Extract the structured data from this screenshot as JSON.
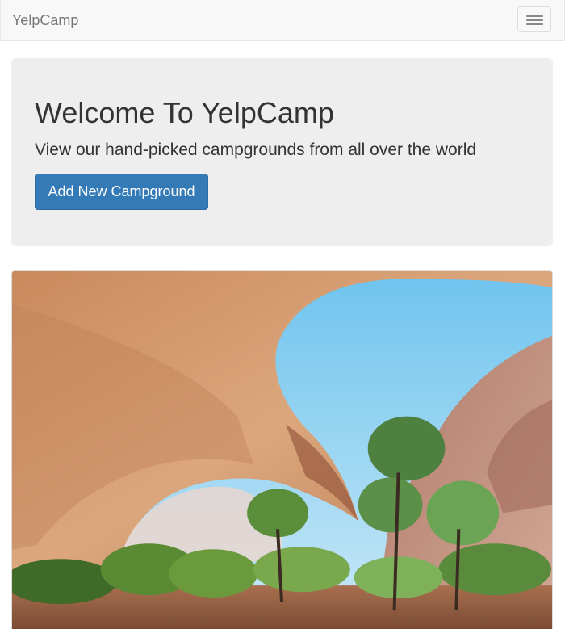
{
  "navbar": {
    "brand": "YelpCamp",
    "toggle_icon": "hamburger-menu-icon"
  },
  "jumbotron": {
    "title": "Welcome To YelpCamp",
    "lead": "View our hand-picked campgrounds from all over the world",
    "button_label": "Add New Campground"
  },
  "colors": {
    "primary": "#337ab7",
    "jumbotron_bg": "#eeeeee",
    "navbar_bg": "#f8f8f8",
    "sky": "#5fb8e6",
    "rock": "#d4956a"
  },
  "campground_image": {
    "subject": "sandstone arch with trees under blue sky"
  }
}
